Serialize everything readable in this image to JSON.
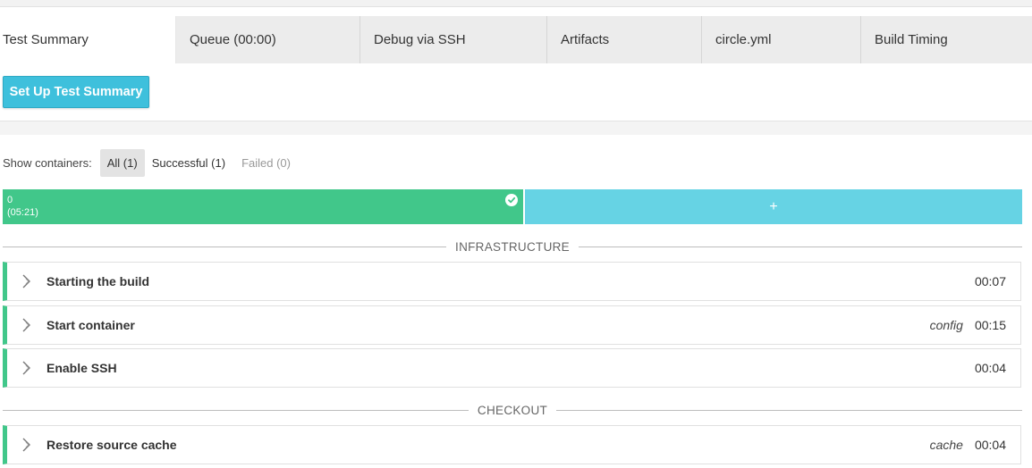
{
  "tabs": [
    {
      "label": "Test Summary",
      "active": true
    },
    {
      "label": "Queue (00:00)",
      "active": false
    },
    {
      "label": "Debug via SSH",
      "active": false
    },
    {
      "label": "Artifacts",
      "active": false
    },
    {
      "label": "circle.yml",
      "active": false
    },
    {
      "label": "Build Timing",
      "active": false
    }
  ],
  "setup_button": "Set Up Test Summary",
  "filters": {
    "label": "Show containers:",
    "all": "All (1)",
    "successful": "Successful (1)",
    "failed": "Failed (0)"
  },
  "container": {
    "index": "0",
    "time": "(05:21)",
    "status": "success",
    "add_symbol": "+"
  },
  "sections": [
    {
      "title": "INFRASTRUCTURE",
      "steps": [
        {
          "name": "Starting the build",
          "tag": "",
          "duration": "00:07"
        },
        {
          "name": "Start container",
          "tag": "config",
          "duration": "00:15"
        },
        {
          "name": "Enable SSH",
          "tag": "",
          "duration": "00:04"
        }
      ]
    },
    {
      "title": "CHECKOUT",
      "steps": [
        {
          "name": "Restore source cache",
          "tag": "cache",
          "duration": "00:04"
        }
      ]
    }
  ],
  "colors": {
    "success": "#41c78a",
    "accent": "#3ec0dc",
    "add_bar": "#66d3e4"
  },
  "icons": {
    "container_status": "check-circle-icon",
    "step_expand": "chevron-right-icon"
  }
}
